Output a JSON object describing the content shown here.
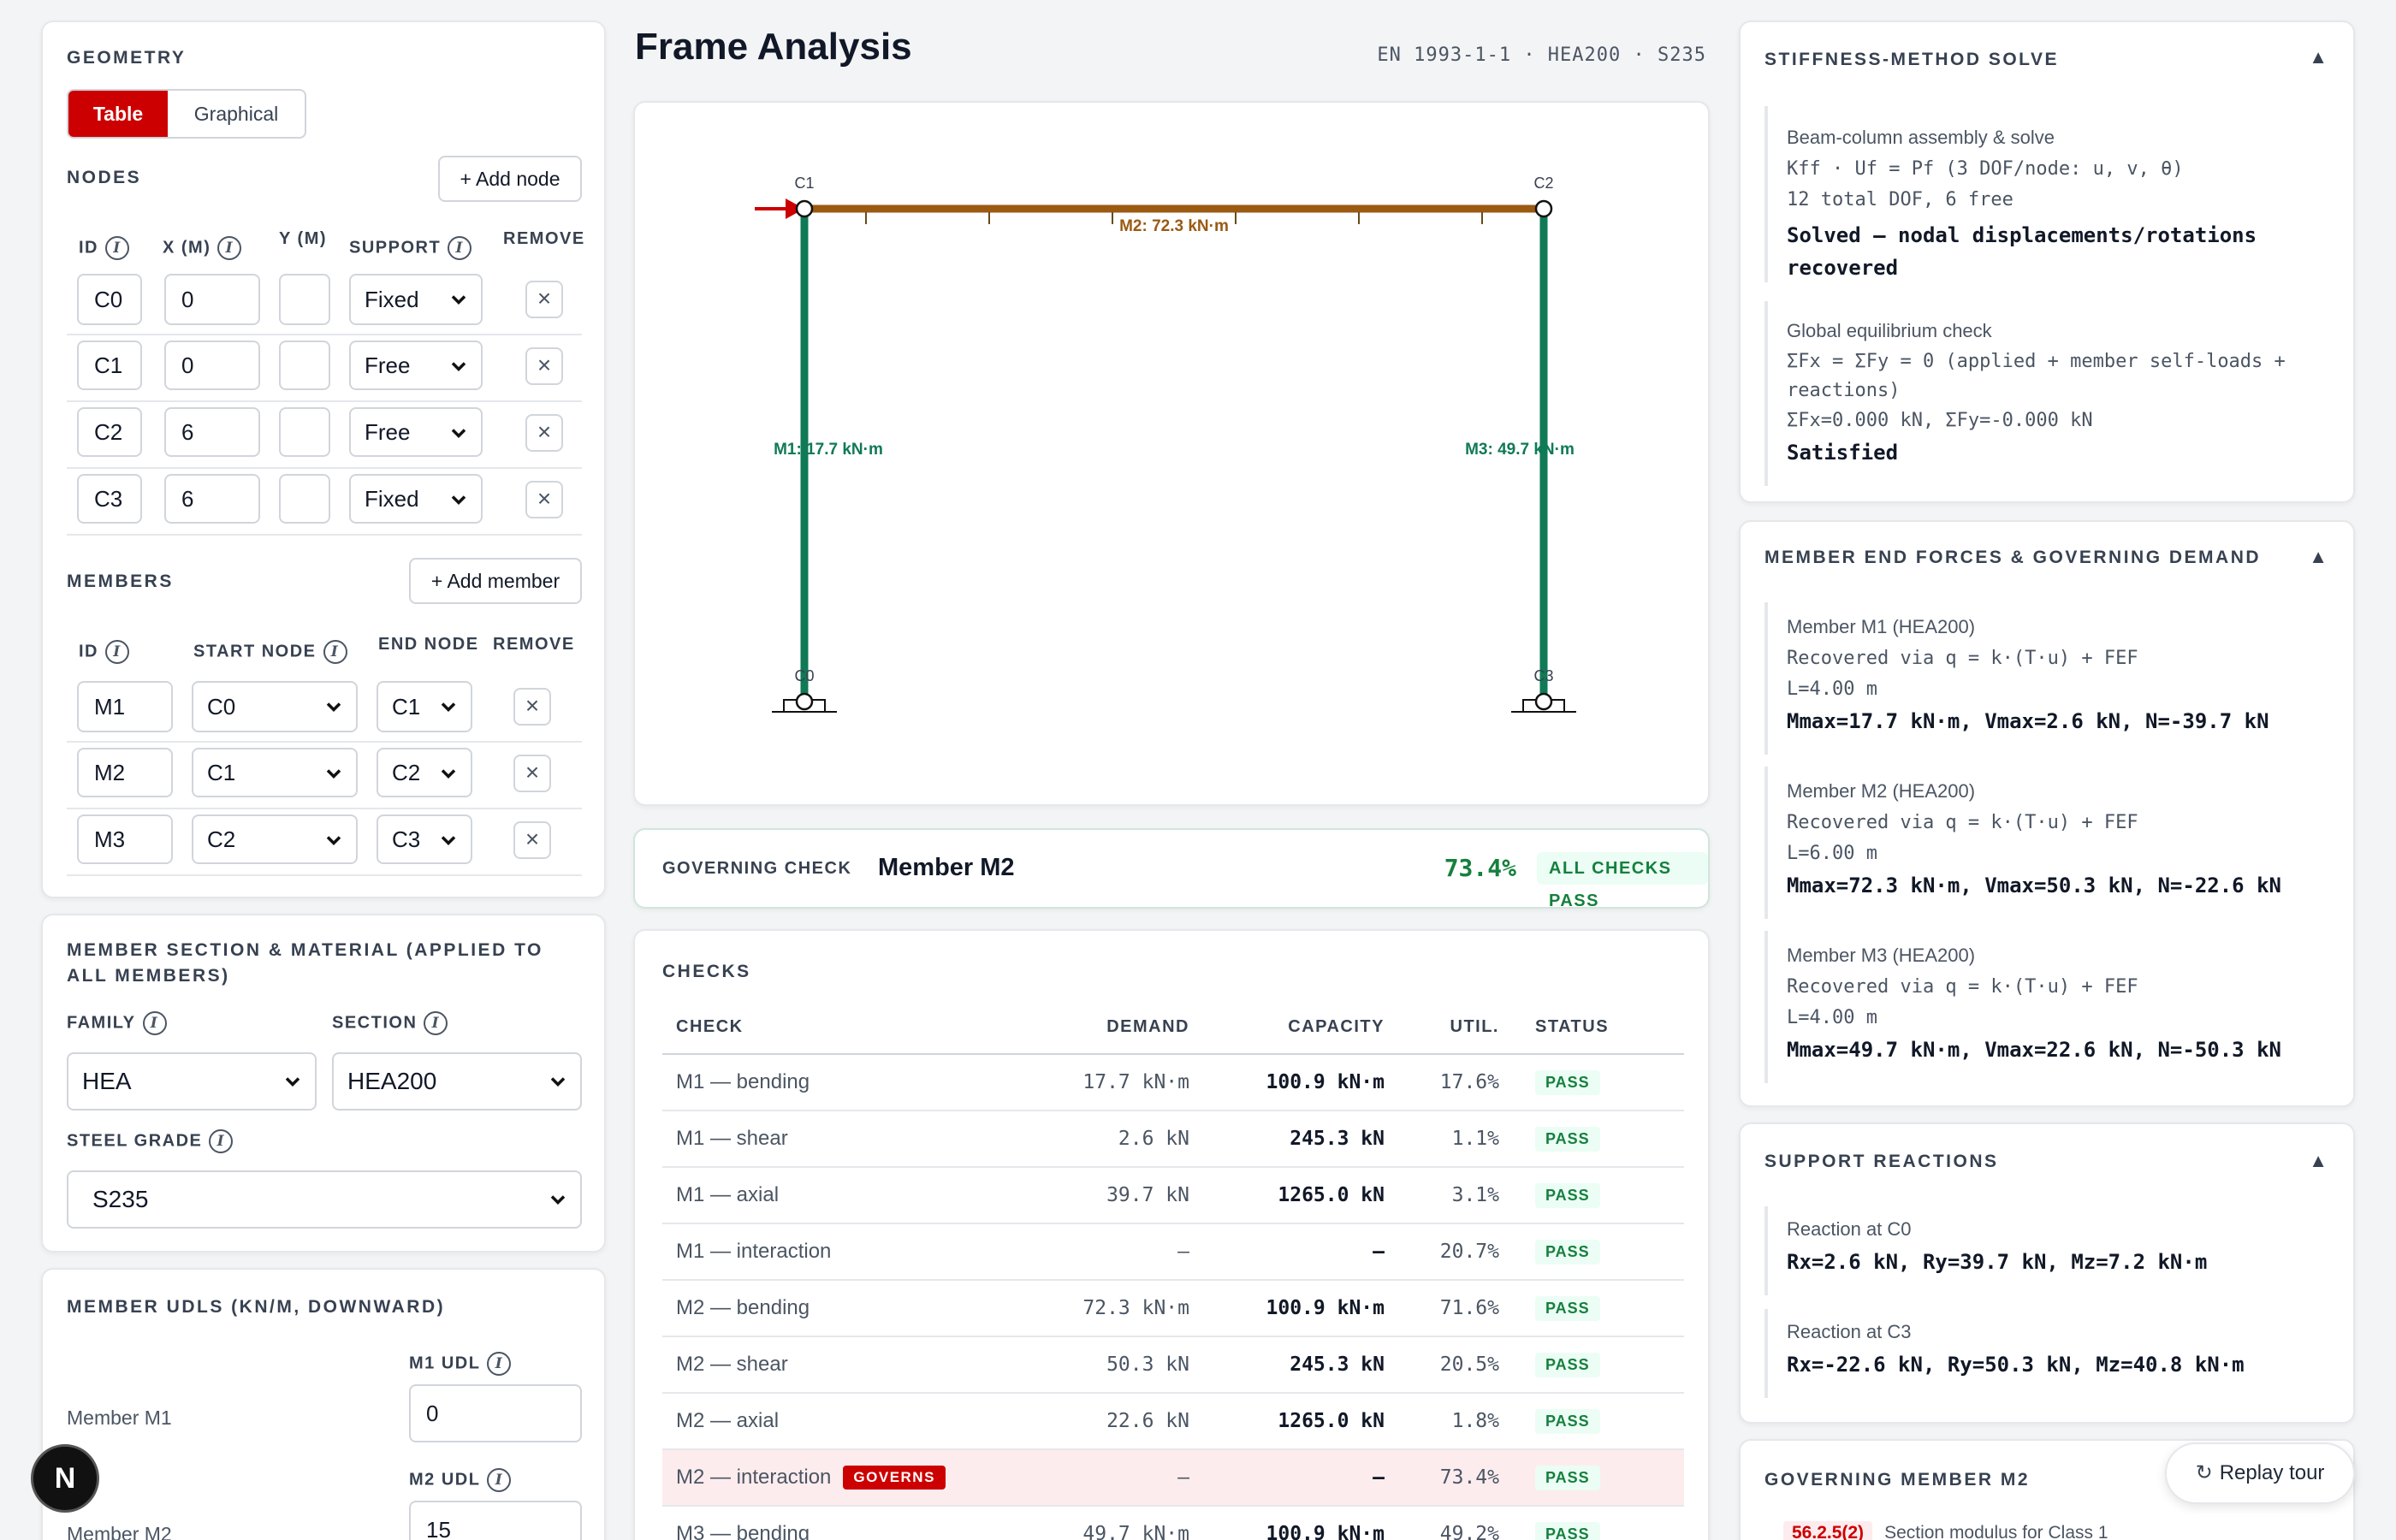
{
  "header": {
    "title": "Frame Analysis",
    "meta": "EN 1993-1-1 · HEA200 · S235"
  },
  "geometry": {
    "title": "Geometry",
    "toggle": {
      "table": "Table",
      "graphical": "Graphical"
    },
    "nodes_title": "Nodes",
    "add_node": "+ Add node",
    "node_cols": {
      "id": "ID",
      "x": "X (m)",
      "y": "Y (m)",
      "support": "Support",
      "remove": "Remove"
    },
    "nodes": [
      {
        "id": "C0",
        "x": "0",
        "y": "",
        "support": "Fixed"
      },
      {
        "id": "C1",
        "x": "0",
        "y": "",
        "support": "Free"
      },
      {
        "id": "C2",
        "x": "6",
        "y": "",
        "support": "Free"
      },
      {
        "id": "C3",
        "x": "6",
        "y": "",
        "support": "Fixed"
      }
    ],
    "members_title": "Members",
    "add_member": "+ Add member",
    "member_cols": {
      "id": "ID",
      "start": "Start node",
      "end": "End node",
      "remove": "Remove"
    },
    "members": [
      {
        "id": "M1",
        "start": "C0",
        "end": "C1"
      },
      {
        "id": "M2",
        "start": "C1",
        "end": "C2"
      },
      {
        "id": "M3",
        "start": "C2",
        "end": "C3"
      }
    ]
  },
  "section": {
    "title": "Member section & material (applied to all members)",
    "family_label": "Family",
    "family": "HEA",
    "section_label": "Section",
    "section": "HEA200",
    "grade_label": "Steel grade",
    "grade": "S235"
  },
  "udls": {
    "title": "Member UDLs (kN/m, downward)",
    "rows": [
      {
        "member": "Member M1",
        "label": "M1 UDL",
        "value": "0"
      },
      {
        "member": "Member M2",
        "label": "M2 UDL",
        "value": "15"
      }
    ]
  },
  "diagram": {
    "nodes": {
      "c0": "C0",
      "c1": "C1",
      "c2": "C2",
      "c3": "C3"
    },
    "m1": "M1: 17.7 kN·m",
    "m2": "M2: 72.3 kN·m",
    "m3": "M3: 49.7 kN·m",
    "colors": {
      "column": "#0f7a55",
      "beam": "#9a5a12",
      "load": "#cc0000"
    }
  },
  "governing": {
    "label": "Governing check",
    "member": "Member M2",
    "util": "73.4%",
    "status": "All checks pass"
  },
  "checks": {
    "title": "Checks",
    "cols": {
      "check": "Check",
      "demand": "Demand",
      "capacity": "Capacity",
      "util": "Util.",
      "status": "Status"
    },
    "governs_tag": "GOVERNS",
    "rows": [
      {
        "check": "M1 — bending",
        "demand": "17.7 kN·m",
        "capacity": "100.9 kN·m",
        "util": "17.6%",
        "status": "PASS"
      },
      {
        "check": "M1 — shear",
        "demand": "2.6 kN",
        "capacity": "245.3 kN",
        "util": "1.1%",
        "status": "PASS"
      },
      {
        "check": "M1 — axial",
        "demand": "39.7 kN",
        "capacity": "1265.0 kN",
        "util": "3.1%",
        "status": "PASS"
      },
      {
        "check": "M1 — interaction",
        "demand": "—",
        "capacity": "—",
        "util": "20.7%",
        "status": "PASS"
      },
      {
        "check": "M2 — bending",
        "demand": "72.3 kN·m",
        "capacity": "100.9 kN·m",
        "util": "71.6%",
        "status": "PASS"
      },
      {
        "check": "M2 — shear",
        "demand": "50.3 kN",
        "capacity": "245.3 kN",
        "util": "20.5%",
        "status": "PASS"
      },
      {
        "check": "M2 — axial",
        "demand": "22.6 kN",
        "capacity": "1265.0 kN",
        "util": "1.8%",
        "status": "PASS"
      },
      {
        "check": "M2 — interaction",
        "demand": "—",
        "capacity": "—",
        "util": "73.4%",
        "status": "PASS"
      },
      {
        "check": "M3 — bending",
        "demand": "49.7 kN·m",
        "capacity": "100.9 kN·m",
        "util": "49.2%",
        "status": "PASS"
      }
    ]
  },
  "solve": {
    "title": "Stiffness-method solve",
    "assembly_caption": "Beam-column assembly & solve",
    "eq": "Kff · Uf = Pf (3 DOF/node: u, v, θ)",
    "dof": "12 total DOF, 6 free",
    "solved": "Solved — nodal displacements/rotations recovered",
    "eq_caption": "Global equilibrium check",
    "eq_line": "ΣFx = ΣFy = 0 (applied + member self-loads + reactions)",
    "sums": "ΣFx=0.000 kN, ΣFy=-0.000 kN",
    "satisfied": "Satisfied"
  },
  "end_forces": {
    "title": "Member end forces & governing demand",
    "items": [
      {
        "title": "Member M1 (HEA200)",
        "method": "Recovered via q = k·(T·u) + FEF",
        "length": "L=4.00 m",
        "result": "Mmax=17.7 kN·m, Vmax=2.6 kN, N=-39.7 kN"
      },
      {
        "title": "Member M2 (HEA200)",
        "method": "Recovered via q = k·(T·u) + FEF",
        "length": "L=6.00 m",
        "result": "Mmax=72.3 kN·m, Vmax=50.3 kN, N=-22.6 kN"
      },
      {
        "title": "Member M3 (HEA200)",
        "method": "Recovered via q = k·(T·u) + FEF",
        "length": "L=4.00 m",
        "result": "Mmax=49.7 kN·m, Vmax=22.6 kN, N=-50.3 kN"
      }
    ]
  },
  "reactions": {
    "title": "Support reactions",
    "items": [
      {
        "title": "Reaction at C0",
        "result": "Rx=2.6 kN, Ry=39.7 kN, Mz=7.2 kN·m"
      },
      {
        "title": "Reaction at C3",
        "result": "Rx=-22.6 kN, Ry=50.3 kN, Mz=40.8 kN·m"
      }
    ]
  },
  "gov_member": {
    "title": "Governing member M2",
    "tag": "56.2.5(2)",
    "text": "Section modulus for Class 1"
  },
  "replay": "Replay tour",
  "avatar": "N"
}
